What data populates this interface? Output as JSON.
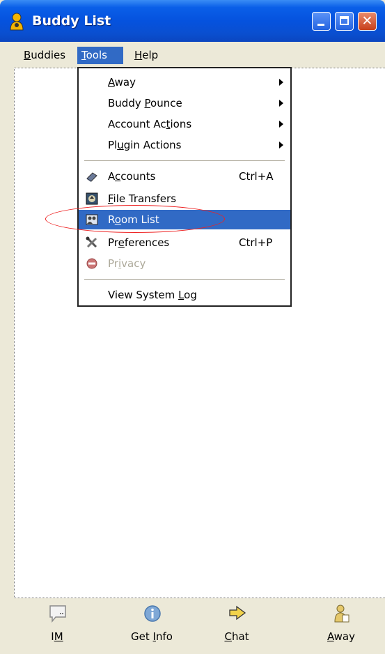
{
  "window": {
    "title": "Buddy List"
  },
  "menubar": {
    "buddies": {
      "accel": "B",
      "rest": "uddies"
    },
    "tools": {
      "accel": "T",
      "rest": "ools"
    },
    "help": {
      "accel": "H",
      "rest": "elp"
    }
  },
  "tools_menu": {
    "away": {
      "accel": "A",
      "rest": "way"
    },
    "buddy_pounce": {
      "pre": "Buddy ",
      "accel": "P",
      "rest": "ounce"
    },
    "account_actions": {
      "pre": "Account Ac",
      "accel": "t",
      "rest": "ions"
    },
    "plugin_actions": {
      "pre": "Pl",
      "accel": "u",
      "rest": "gin Actions"
    },
    "accounts": {
      "pre": "A",
      "accel": "c",
      "rest": "counts",
      "shortcut": "Ctrl+A"
    },
    "file_transfers": {
      "pre": "",
      "accel": "F",
      "rest": "ile Transfers"
    },
    "room_list": {
      "pre": "R",
      "accel": "o",
      "rest": "om List"
    },
    "preferences": {
      "pre": "Pr",
      "accel": "e",
      "rest": "ferences",
      "shortcut": "Ctrl+P"
    },
    "privacy": {
      "pre": "Pr",
      "accel": "i",
      "rest": "vacy"
    },
    "view_system_log": {
      "pre": "View System ",
      "accel": "L",
      "rest": "og"
    }
  },
  "toolbar": {
    "im": {
      "pre": "I",
      "accel": "M",
      "rest": ""
    },
    "get_info": {
      "pre": "Get ",
      "accel": "I",
      "rest": "nfo"
    },
    "chat": {
      "pre": "",
      "accel": "C",
      "rest": "hat"
    },
    "away": {
      "pre": "",
      "accel": "A",
      "rest": "way"
    }
  },
  "colors": {
    "highlight": "#316ac5",
    "titlebar": "#0552de",
    "annotation": "#e22222"
  },
  "icons": [
    "buddy-app-icon",
    "accounts-icon",
    "file-transfers-icon",
    "room-list-icon",
    "preferences-icon",
    "privacy-icon",
    "im-icon",
    "info-icon",
    "chat-icon",
    "away-icon"
  ]
}
